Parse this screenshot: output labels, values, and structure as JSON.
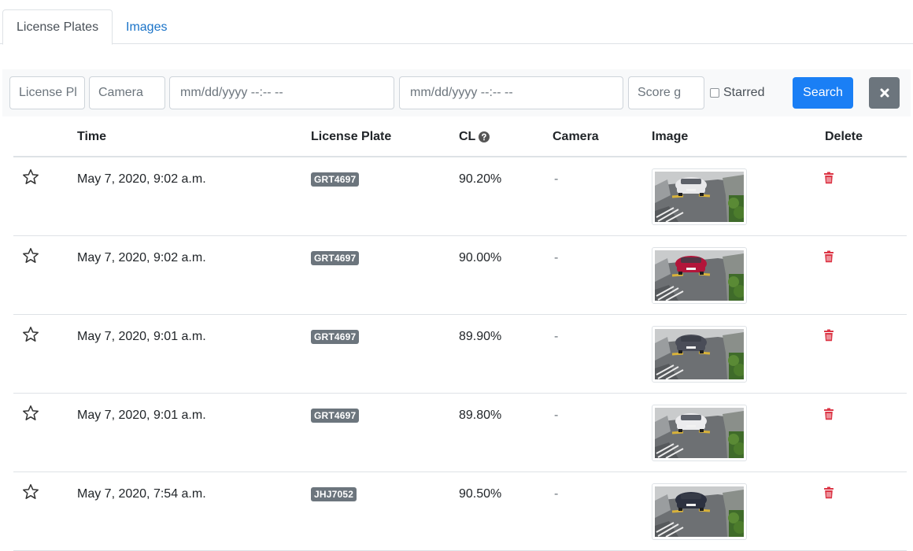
{
  "tabs": [
    {
      "label": "License Plates",
      "active": true
    },
    {
      "label": "Images",
      "active": false
    }
  ],
  "filters": {
    "plate_placeholder": "License Pl",
    "camera_placeholder": "Camera",
    "date_from_placeholder": "mm/dd/yyyy --:-- --",
    "date_to_placeholder": "mm/dd/yyyy --:-- --",
    "score_placeholder": "Score g",
    "starred_label": "Starred",
    "starred_checked": false,
    "search_label": "Search",
    "clear_icon": "times-icon"
  },
  "table": {
    "headers": {
      "time": "Time",
      "plate": "License Plate",
      "cl": "CL",
      "camera": "Camera",
      "image": "Image",
      "delete": "Delete"
    },
    "rows": [
      {
        "starred": false,
        "time": "May 7, 2020, 9:02 a.m.",
        "plate": "GRT4697",
        "cl": "90.20%",
        "camera": "-",
        "car_color": "#e8e8ea"
      },
      {
        "starred": false,
        "time": "May 7, 2020, 9:02 a.m.",
        "plate": "GRT4697",
        "cl": "90.00%",
        "camera": "-",
        "car_color": "#b3153a"
      },
      {
        "starred": false,
        "time": "May 7, 2020, 9:01 a.m.",
        "plate": "GRT4697",
        "cl": "89.90%",
        "camera": "-",
        "car_color": "#4a4d58"
      },
      {
        "starred": false,
        "time": "May 7, 2020, 9:01 a.m.",
        "plate": "GRT4697",
        "cl": "89.80%",
        "camera": "-",
        "car_color": "#ececee"
      },
      {
        "starred": false,
        "time": "May 7, 2020, 7:54 a.m.",
        "plate": "JHJ7052",
        "cl": "90.50%",
        "camera": "-",
        "car_color": "#2c3140"
      }
    ]
  },
  "colors": {
    "primary": "#1a7ff5",
    "secondary": "#6c757d",
    "danger": "#dc3545",
    "link": "#1a73c8"
  }
}
